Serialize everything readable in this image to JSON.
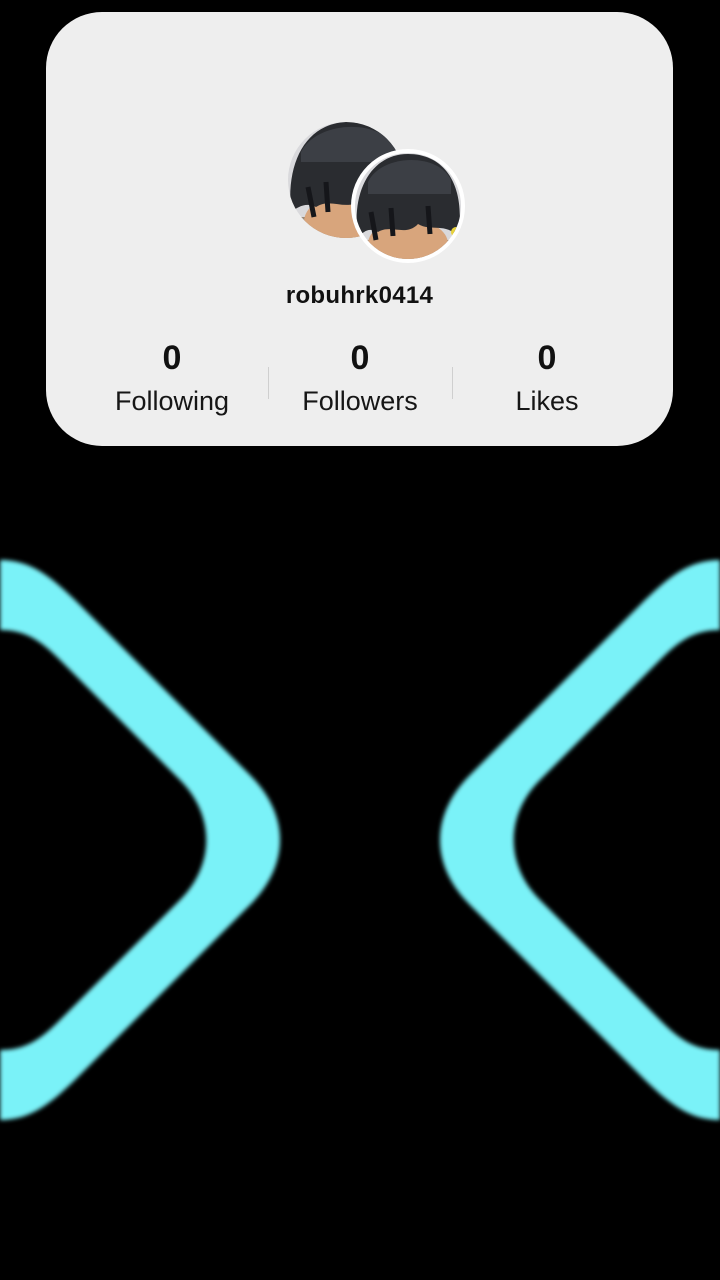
{
  "profile": {
    "username": "robuhrk0414",
    "avatar_icon": "avatar-character-icon",
    "stats": {
      "following": {
        "value": "0",
        "label": "Following"
      },
      "followers": {
        "value": "0",
        "label": "Followers"
      },
      "likes": {
        "value": "0",
        "label": "Likes"
      }
    }
  },
  "colors": {
    "background": "#000000",
    "card": "#eeeeee",
    "accent_cyan": "#7af2f8"
  }
}
